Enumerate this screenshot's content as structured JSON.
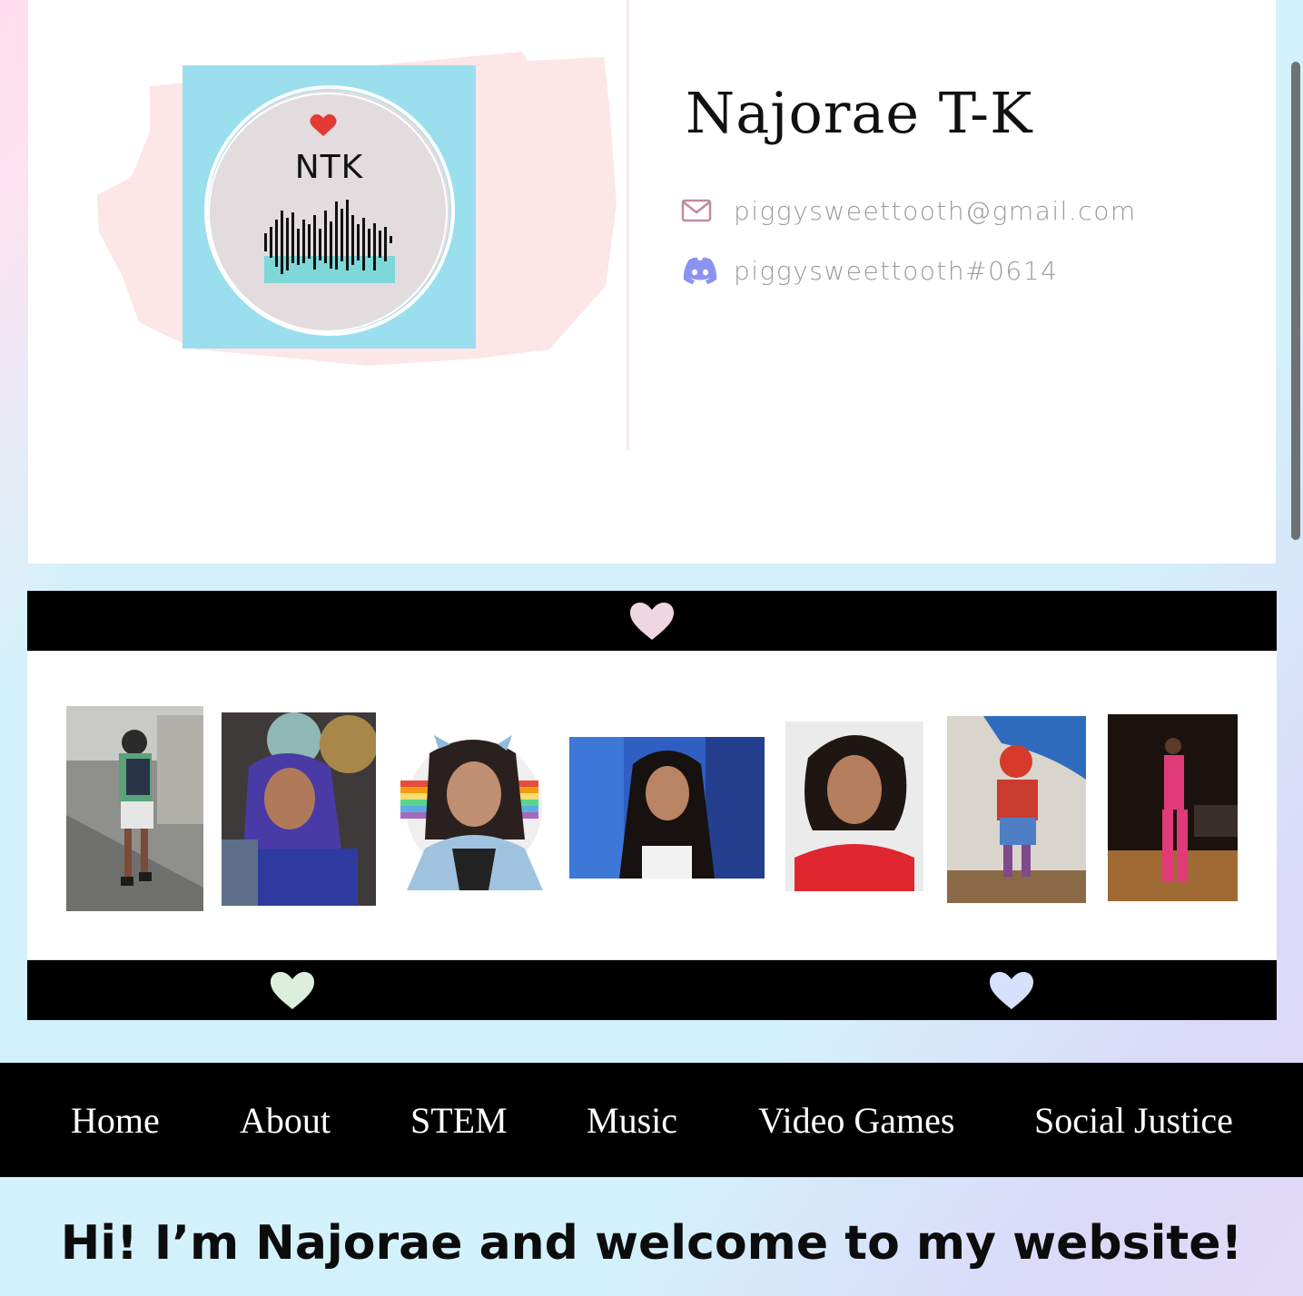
{
  "profile": {
    "name": "Najorae T-K",
    "logo_text": "NTK",
    "email": "piggysweettooth@gmail.com",
    "discord": "piggysweettooth#0614"
  },
  "icons": {
    "email": "envelope-icon",
    "discord": "discord-icon",
    "heart": "heart-icon"
  },
  "colors": {
    "heart_top": "#efd6e0",
    "heart_bottom_left": "#dcefdd",
    "heart_bottom_right": "#d6e2fb",
    "logo_bg": "#9bdeee",
    "email_icon": "#c08aa4",
    "discord_icon": "#8a93f0"
  },
  "gallery": {
    "photos": [
      {
        "label": "photo-street-walk"
      },
      {
        "label": "photo-purple-wig"
      },
      {
        "label": "photo-cartoon-avatar"
      },
      {
        "label": "photo-blue-backdrop"
      },
      {
        "label": "photo-red-shirt"
      },
      {
        "label": "photo-costume"
      },
      {
        "label": "photo-stage-performance"
      }
    ]
  },
  "nav": {
    "items": [
      "Home",
      "About",
      "STEM",
      "Music",
      "Video Games",
      "Social Justice"
    ]
  },
  "welcome": "Hi! I’m Najorae and welcome to my website!"
}
